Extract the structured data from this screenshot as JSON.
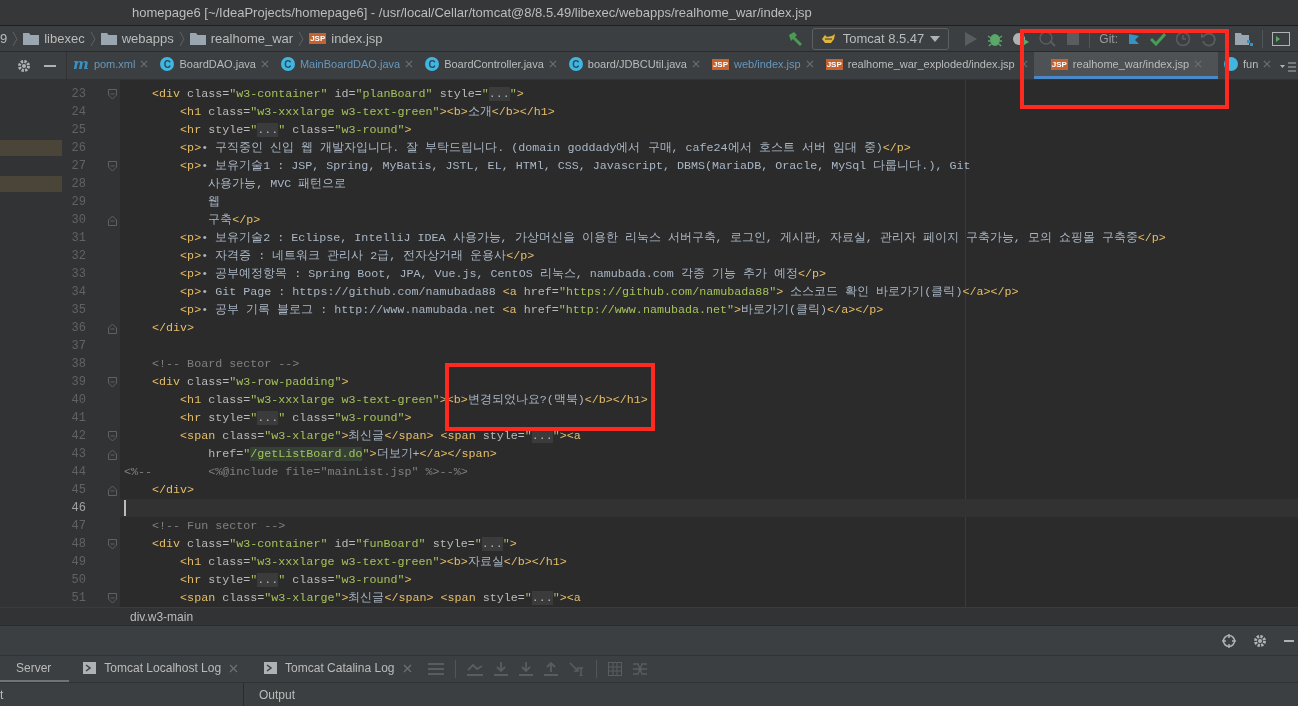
{
  "window": {
    "title": "homepage6 [~/IdeaProjects/homepage6] - /usr/local/Cellar/tomcat@8/8.5.49/libexec/webapps/realhome_war/index.jsp"
  },
  "breadcrumbs": [
    {
      "kind": "none",
      "text": "9"
    },
    {
      "kind": "folder",
      "text": "libexec"
    },
    {
      "kind": "folder",
      "text": "webapps"
    },
    {
      "kind": "folder",
      "text": "realhome_war"
    },
    {
      "kind": "jsp",
      "glyph": "JSP",
      "text": "index.jsp"
    }
  ],
  "toolbar": {
    "run_config": "Tomcat 8.5.47",
    "vcs_label": "Git:",
    "buttons": [
      {
        "kind": "run",
        "disabled": true
      },
      {
        "kind": "debug",
        "disabled": false
      },
      {
        "kind": "coverage",
        "disabled": false
      },
      {
        "kind": "profile",
        "disabled": true
      },
      {
        "kind": "stop",
        "disabled": true
      }
    ],
    "vcs_buttons": [
      {
        "kind": "update"
      },
      {
        "kind": "commit"
      },
      {
        "kind": "history"
      },
      {
        "kind": "revert"
      }
    ]
  },
  "tabs": [
    {
      "kind": "maven",
      "glyph": "m",
      "label": "pom.xml",
      "modified": true,
      "selected": false
    },
    {
      "kind": "class",
      "glyph": "C",
      "label": "BoardDAO.java",
      "modified": false,
      "selected": false
    },
    {
      "kind": "class",
      "glyph": "C",
      "label": "MainBoardDAO.java",
      "modified": true,
      "selected": false
    },
    {
      "kind": "class",
      "glyph": "C",
      "label": "BoardController.java",
      "modified": false,
      "selected": false
    },
    {
      "kind": "class",
      "glyph": "C",
      "label": "board/JDBCUtil.java",
      "modified": false,
      "selected": false
    },
    {
      "kind": "jsp",
      "glyph": "JSP",
      "label": "web/index.jsp",
      "modified": true,
      "selected": false
    },
    {
      "kind": "jsp",
      "glyph": "JSP",
      "label": "realhome_war_exploded/index.jsp",
      "modified": false,
      "selected": false
    },
    {
      "kind": "jsp",
      "glyph": "JSP",
      "label": "realhome_war/index.jsp",
      "modified": false,
      "selected": true
    },
    {
      "kind": "class",
      "label": "fun",
      "modified": false,
      "selected": false
    }
  ],
  "editor": {
    "lines": [
      {
        "num": "23",
        "fold_start": true,
        "fold_end": false,
        "changed": false,
        "current": false,
        "tokens": [
          {
            "kind": "tag",
            "text": "    <div"
          },
          {
            "kind": "attr",
            "text": " class="
          },
          {
            "kind": "str",
            "text": "\"w3-container\""
          },
          {
            "kind": "attr",
            "text": " id="
          },
          {
            "kind": "str",
            "text": "\"planBoard\""
          },
          {
            "kind": "attr",
            "text": " style="
          },
          {
            "kind": "str",
            "text": "\""
          },
          {
            "kind": "dots",
            "text": "..."
          },
          {
            "kind": "str",
            "text": "\""
          },
          {
            "kind": "tag",
            "text": ">"
          }
        ]
      },
      {
        "num": "24",
        "fold_start": false,
        "fold_end": false,
        "changed": false,
        "current": false,
        "tokens": [
          {
            "kind": "tag",
            "text": "        <h1"
          },
          {
            "kind": "attr",
            "text": " class="
          },
          {
            "kind": "str",
            "text": "\"w3-xxxlarge w3-text-green\""
          },
          {
            "kind": "tag",
            "text": "><b>"
          },
          {
            "kind": "text",
            "text": "소개"
          },
          {
            "kind": "tag",
            "text": "</b></h1>"
          }
        ]
      },
      {
        "num": "25",
        "fold_start": false,
        "fold_end": false,
        "changed": false,
        "current": false,
        "tokens": [
          {
            "kind": "tag",
            "text": "        <hr"
          },
          {
            "kind": "attr",
            "text": " style="
          },
          {
            "kind": "str",
            "text": "\""
          },
          {
            "kind": "dots",
            "text": "..."
          },
          {
            "kind": "str",
            "text": "\""
          },
          {
            "kind": "attr",
            "text": " class="
          },
          {
            "kind": "str",
            "text": "\"w3-round\""
          },
          {
            "kind": "tag",
            "text": ">"
          }
        ]
      },
      {
        "num": "26",
        "fold_start": false,
        "fold_end": false,
        "changed": true,
        "current": false,
        "tokens": [
          {
            "kind": "tag",
            "text": "        <p>"
          },
          {
            "kind": "text",
            "text": "• 구직중인 신입 웹 개발자입니다. 잘 부탁드립니다. (domain goddady에서 구매, cafe24에서 호스트 서버 임대 중)"
          },
          {
            "kind": "tag",
            "text": "</p>"
          }
        ]
      },
      {
        "num": "27",
        "fold_start": true,
        "fold_end": false,
        "changed": false,
        "current": false,
        "tokens": [
          {
            "kind": "tag",
            "text": "        <p>"
          },
          {
            "kind": "text",
            "text": "• 보유기술1 : JSP, Spring, MyBatis, JSTL, EL, HTMl, CSS, Javascript, DBMS(MariaDB, Oracle, MySql 다룹니다.), Git"
          }
        ]
      },
      {
        "num": "28",
        "fold_start": false,
        "fold_end": false,
        "changed": true,
        "current": false,
        "tokens": [
          {
            "kind": "text",
            "text": "            사용가능, MVC 패턴으로"
          }
        ]
      },
      {
        "num": "29",
        "fold_start": false,
        "fold_end": false,
        "changed": false,
        "current": false,
        "tokens": [
          {
            "kind": "text",
            "text": "            웹"
          }
        ]
      },
      {
        "num": "30",
        "fold_start": false,
        "fold_end": true,
        "changed": false,
        "current": false,
        "tokens": [
          {
            "kind": "text",
            "text": "            구축"
          },
          {
            "kind": "tag",
            "text": "</p>"
          }
        ]
      },
      {
        "num": "31",
        "fold_start": false,
        "fold_end": false,
        "changed": false,
        "current": false,
        "tokens": [
          {
            "kind": "tag",
            "text": "        <p>"
          },
          {
            "kind": "text",
            "text": "• 보유기술2 : Eclipse, IntelliJ IDEA 사용가능, 가상머신을 이용한 리눅스 서버구축, 로그인, 게시판, 자료실, 관리자 페이지 구축가능, 모의 쇼핑몰 구축중"
          },
          {
            "kind": "tag",
            "text": "</p>"
          }
        ]
      },
      {
        "num": "32",
        "fold_start": false,
        "fold_end": false,
        "changed": false,
        "current": false,
        "tokens": [
          {
            "kind": "tag",
            "text": "        <p>"
          },
          {
            "kind": "text",
            "text": "• 자격증 : 네트워크 관리사 2급, 전자상거래 운용사"
          },
          {
            "kind": "tag",
            "text": "</p>"
          }
        ]
      },
      {
        "num": "33",
        "fold_start": false,
        "fold_end": false,
        "changed": false,
        "current": false,
        "tokens": [
          {
            "kind": "tag",
            "text": "        <p>"
          },
          {
            "kind": "text",
            "text": "• 공부예정항목 : Spring Boot, JPA, Vue.js, CentOS 리눅스, namubada.com 각종 기능 추가 예정"
          },
          {
            "kind": "tag",
            "text": "</p>"
          }
        ]
      },
      {
        "num": "34",
        "fold_start": false,
        "fold_end": false,
        "changed": false,
        "current": false,
        "tokens": [
          {
            "kind": "tag",
            "text": "        <p>"
          },
          {
            "kind": "text",
            "text": "• Git Page : https://github.com/namubada88 "
          },
          {
            "kind": "tag",
            "text": "<a"
          },
          {
            "kind": "attr",
            "text": " href="
          },
          {
            "kind": "str",
            "text": "\"https://github.com/namubada88\""
          },
          {
            "kind": "tag",
            "text": ">"
          },
          {
            "kind": "text",
            "text": " 소스코드 확인 바로가기(클릭)"
          },
          {
            "kind": "tag",
            "text": "</a></p>"
          }
        ]
      },
      {
        "num": "35",
        "fold_start": false,
        "fold_end": false,
        "changed": false,
        "current": false,
        "tokens": [
          {
            "kind": "tag",
            "text": "        <p>"
          },
          {
            "kind": "text",
            "text": "• 공부 기록 블로그 : http://www.namubada.net "
          },
          {
            "kind": "tag",
            "text": "<a"
          },
          {
            "kind": "attr",
            "text": " href="
          },
          {
            "kind": "str",
            "text": "\"http://www.namubada.net\""
          },
          {
            "kind": "tag",
            "text": ">"
          },
          {
            "kind": "text",
            "text": "바로가기(클릭)"
          },
          {
            "kind": "tag",
            "text": "</a></p>"
          }
        ]
      },
      {
        "num": "36",
        "fold_start": false,
        "fold_end": true,
        "changed": false,
        "current": false,
        "tokens": [
          {
            "kind": "tag",
            "text": "    </div>"
          }
        ]
      },
      {
        "num": "37",
        "fold_start": false,
        "fold_end": false,
        "changed": false,
        "current": false
      },
      {
        "num": "38",
        "fold_start": false,
        "fold_end": false,
        "changed": false,
        "current": false,
        "tokens": [
          {
            "kind": "comment",
            "text": "    <!-- Board sector -->"
          }
        ]
      },
      {
        "num": "39",
        "fold_start": true,
        "fold_end": false,
        "changed": false,
        "current": false,
        "tokens": [
          {
            "kind": "tag",
            "text": "    <div"
          },
          {
            "kind": "attr",
            "text": " class="
          },
          {
            "kind": "str",
            "text": "\"w3-row-padding\""
          },
          {
            "kind": "tag",
            "text": ">"
          }
        ]
      },
      {
        "num": "40",
        "fold_start": false,
        "fold_end": false,
        "changed": false,
        "current": false,
        "tokens": [
          {
            "kind": "tag",
            "text": "        <h1"
          },
          {
            "kind": "attr",
            "text": " class="
          },
          {
            "kind": "str",
            "text": "\"w3-xxxlarge w3-text-green\""
          },
          {
            "kind": "tag",
            "text": "><b>"
          },
          {
            "kind": "text",
            "text": "변경되었나요?(맥북)"
          },
          {
            "kind": "tag",
            "text": "</b></h1>"
          }
        ]
      },
      {
        "num": "41",
        "fold_start": false,
        "fold_end": false,
        "changed": false,
        "current": false,
        "tokens": [
          {
            "kind": "tag",
            "text": "        <hr"
          },
          {
            "kind": "attr",
            "text": " style="
          },
          {
            "kind": "str",
            "text": "\""
          },
          {
            "kind": "dots",
            "text": "..."
          },
          {
            "kind": "str",
            "text": "\""
          },
          {
            "kind": "attr",
            "text": " class="
          },
          {
            "kind": "str",
            "text": "\"w3-round\""
          },
          {
            "kind": "tag",
            "text": ">"
          }
        ]
      },
      {
        "num": "42",
        "fold_start": true,
        "fold_end": false,
        "changed": false,
        "current": false,
        "tokens": [
          {
            "kind": "tag",
            "text": "        <span"
          },
          {
            "kind": "attr",
            "text": " class="
          },
          {
            "kind": "str",
            "text": "\"w3-xlarge\""
          },
          {
            "kind": "tag",
            "text": ">"
          },
          {
            "kind": "text",
            "text": "최신글"
          },
          {
            "kind": "tag",
            "text": "</span> <span"
          },
          {
            "kind": "attr",
            "text": " style="
          },
          {
            "kind": "str",
            "text": "\""
          },
          {
            "kind": "dots",
            "text": "..."
          },
          {
            "kind": "str",
            "text": "\""
          },
          {
            "kind": "tag",
            "text": "><a"
          }
        ]
      },
      {
        "num": "43",
        "fold_start": false,
        "fold_end": true,
        "changed": false,
        "current": false,
        "tokens": [
          {
            "kind": "attr",
            "text": "            href="
          },
          {
            "kind": "str",
            "text": "\""
          },
          {
            "kind": "ref",
            "text": "/getListBoard.do"
          },
          {
            "kind": "str",
            "text": "\""
          },
          {
            "kind": "tag",
            "text": ">"
          },
          {
            "kind": "text",
            "text": "더보기+"
          },
          {
            "kind": "tag",
            "text": "</a></span>"
          }
        ]
      },
      {
        "num": "44",
        "fold_start": false,
        "fold_end": false,
        "changed": false,
        "current": false,
        "tokens": [
          {
            "kind": "comment",
            "text": "<%--        <%@include file=\"mainList.jsp\" %>--%>"
          }
        ]
      },
      {
        "num": "45",
        "fold_start": false,
        "fold_end": true,
        "changed": false,
        "current": false,
        "tokens": [
          {
            "kind": "tag",
            "text": "    </div>"
          }
        ]
      },
      {
        "num": "46",
        "fold_start": false,
        "fold_end": false,
        "changed": false,
        "current": true
      },
      {
        "num": "47",
        "fold_start": false,
        "fold_end": false,
        "changed": false,
        "current": false,
        "tokens": [
          {
            "kind": "comment",
            "text": "    <!-- Fun sector -->"
          }
        ]
      },
      {
        "num": "48",
        "fold_start": true,
        "fold_end": false,
        "changed": false,
        "current": false,
        "tokens": [
          {
            "kind": "tag",
            "text": "    <div"
          },
          {
            "kind": "attr",
            "text": " class="
          },
          {
            "kind": "str",
            "text": "\"w3-container\""
          },
          {
            "kind": "attr",
            "text": " id="
          },
          {
            "kind": "str",
            "text": "\"funBoard\""
          },
          {
            "kind": "attr",
            "text": " style="
          },
          {
            "kind": "str",
            "text": "\""
          },
          {
            "kind": "dots",
            "text": "..."
          },
          {
            "kind": "str",
            "text": "\""
          },
          {
            "kind": "tag",
            "text": ">"
          }
        ]
      },
      {
        "num": "49",
        "fold_start": false,
        "fold_end": false,
        "changed": false,
        "current": false,
        "tokens": [
          {
            "kind": "tag",
            "text": "        <h1"
          },
          {
            "kind": "attr",
            "text": " class="
          },
          {
            "kind": "str",
            "text": "\"w3-xxxlarge w3-text-green\""
          },
          {
            "kind": "tag",
            "text": "><b>"
          },
          {
            "kind": "text",
            "text": "자료실"
          },
          {
            "kind": "tag",
            "text": "</b></h1>"
          }
        ]
      },
      {
        "num": "50",
        "fold_start": false,
        "fold_end": false,
        "changed": false,
        "current": false,
        "tokens": [
          {
            "kind": "tag",
            "text": "        <hr"
          },
          {
            "kind": "attr",
            "text": " style="
          },
          {
            "kind": "str",
            "text": "\""
          },
          {
            "kind": "dots",
            "text": "..."
          },
          {
            "kind": "str",
            "text": "\""
          },
          {
            "kind": "attr",
            "text": " class="
          },
          {
            "kind": "str",
            "text": "\"w3-round\""
          },
          {
            "kind": "tag",
            "text": ">"
          }
        ]
      },
      {
        "num": "51",
        "fold_start": true,
        "fold_end": false,
        "changed": false,
        "current": false,
        "tokens": [
          {
            "kind": "tag",
            "text": "        <span"
          },
          {
            "kind": "attr",
            "text": " class="
          },
          {
            "kind": "str",
            "text": "\"w3-xlarge\""
          },
          {
            "kind": "tag",
            "text": ">"
          },
          {
            "kind": "text",
            "text": "최신글"
          },
          {
            "kind": "tag",
            "text": "</span> <span"
          },
          {
            "kind": "attr",
            "text": " style="
          },
          {
            "kind": "str",
            "text": "\""
          },
          {
            "kind": "dots",
            "text": "..."
          },
          {
            "kind": "str",
            "text": "\""
          },
          {
            "kind": "tag",
            "text": "><a"
          }
        ]
      }
    ],
    "breadcrumb": "div.w3-main"
  },
  "bottom_tabs": [
    {
      "kind": "plain",
      "label": "Server",
      "selected": true,
      "closable": false
    },
    {
      "kind": "console",
      "label": "Tomcat Localhost Log",
      "selected": false,
      "closable": true
    },
    {
      "kind": "console",
      "label": "Tomcat Catalina Log",
      "selected": false,
      "closable": true
    }
  ],
  "bottom_panel": {
    "left_header": "t",
    "right_header": "Output"
  },
  "markup": [
    {
      "kind": "rectangle",
      "color": "#ff2a1f"
    },
    {
      "kind": "rectangle",
      "color": "#ff2a1f"
    }
  ]
}
